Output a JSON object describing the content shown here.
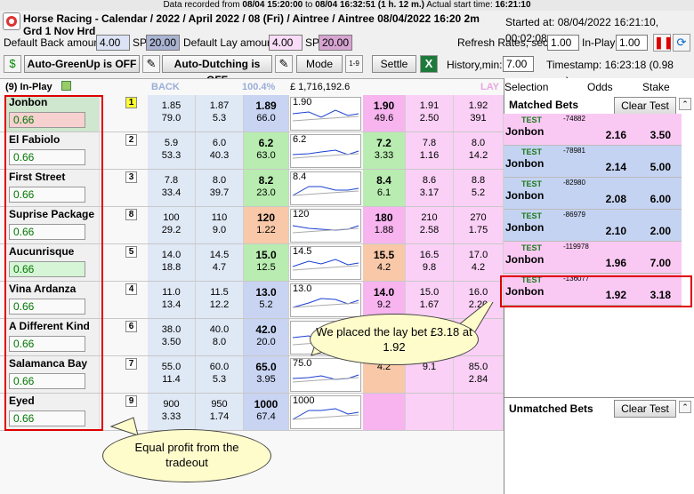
{
  "recorded": {
    "label": "Data recorded from",
    "from": "08/04 15:20:00",
    "to_label": "to",
    "to": "08/04 16:32:51",
    "duration": "(1 h. 12 m.)",
    "start_label": "Actual start time:",
    "start": "16:21:10"
  },
  "header": {
    "title": "Horse Racing - Calendar / 2022 / April 2022 / 08 (Fri) / Aintree / Aintree 08/04/2022 16:20 2m",
    "subtitle": "Grd 1 Nov Hrd",
    "started": "Started at: 08/04/2022 16:21:10, 00:02:08",
    "default_back_label": "Default Back amount:",
    "default_back": "4.00",
    "sp_label": "SP",
    "sp_back": "20.00",
    "default_lay_label": "Default Lay amount:",
    "default_lay": "4.00",
    "sp_lay": "20.00",
    "refresh_label": "Refresh Rates, sec.",
    "refresh": "1.00",
    "inplay_label": "In-Play",
    "inplay": "1.00",
    "autogreen": "Auto-GreenUp is OFF",
    "autodutch": "Auto-Dutching is OFF",
    "mode": "Mode",
    "settle": "Settle",
    "history_label": "History,min:",
    "history": "7.00",
    "timestamp": "Timestamp: 16:23:18 (0.98 sec.)"
  },
  "grid": {
    "inplay": "(9) In-Play",
    "back": "BACK",
    "pct": "100.4%",
    "matched": "£ 1,716,192.6",
    "lay": "LAY",
    "runners": [
      {
        "name": "Jonbon",
        "pl": "0.66",
        "num": "1",
        "b1": [
          "1.85",
          "79.0"
        ],
        "b2": [
          "1.87",
          "5.3"
        ],
        "b3": [
          "1.89",
          "66.0"
        ],
        "spark": "1.90",
        "l1": [
          "1.90",
          "49.6"
        ],
        "l2": [
          "1.91",
          "2.50"
        ],
        "l3": [
          "1.92",
          "391"
        ]
      },
      {
        "name": "El Fabiolo",
        "pl": "0.66",
        "num": "2",
        "b1": [
          "5.9",
          "53.3"
        ],
        "b2": [
          "6.0",
          "40.3"
        ],
        "b3": [
          "6.2",
          "63.0"
        ],
        "spark": "6.2",
        "l1": [
          "7.2",
          "3.33"
        ],
        "l2": [
          "7.8",
          "1.16"
        ],
        "l3": [
          "8.0",
          "14.2"
        ]
      },
      {
        "name": "First Street",
        "pl": "0.66",
        "num": "3",
        "b1": [
          "7.8",
          "33.4"
        ],
        "b2": [
          "8.0",
          "39.7"
        ],
        "b3": [
          "8.2",
          "23.0"
        ],
        "spark": "8.4",
        "l1": [
          "8.4",
          "6.1"
        ],
        "l2": [
          "8.6",
          "3.17"
        ],
        "l3": [
          "8.8",
          "5.2"
        ]
      },
      {
        "name": "Suprise Package",
        "pl": "0.66",
        "num": "8",
        "b1": [
          "100",
          "29.2"
        ],
        "b2": [
          "110",
          "9.0"
        ],
        "b3": [
          "120",
          "1.22"
        ],
        "spark": "120",
        "l1": [
          "180",
          "1.88"
        ],
        "l2": [
          "210",
          "2.58"
        ],
        "l3": [
          "270",
          "1.75"
        ]
      },
      {
        "name": "Aucunrisque",
        "pl": "0.66",
        "num": "5",
        "b1": [
          "14.0",
          "18.8"
        ],
        "b2": [
          "14.5",
          "4.7"
        ],
        "b3": [
          "15.0",
          "12.5"
        ],
        "spark": "14.5",
        "l1": [
          "15.5",
          "4.2"
        ],
        "l2": [
          "16.5",
          "9.8"
        ],
        "l3": [
          "17.0",
          "4.2"
        ]
      },
      {
        "name": "Vina Ardanza",
        "pl": "0.66",
        "num": "4",
        "b1": [
          "11.0",
          "13.4"
        ],
        "b2": [
          "11.5",
          "12.2"
        ],
        "b3": [
          "13.0",
          "5.2"
        ],
        "spark": "13.0",
        "l1": [
          "14.0",
          "9.2"
        ],
        "l2": [
          "15.0",
          "1.67"
        ],
        "l3": [
          "16.0",
          "2.20"
        ]
      },
      {
        "name": "A Different Kind",
        "pl": "0.66",
        "num": "6",
        "b1": [
          "38.0",
          "3.50"
        ],
        "b2": [
          "40.0",
          "8.0"
        ],
        "b3": [
          "42.0",
          "20.0"
        ],
        "spark": "",
        "l1": [
          "",
          ""
        ],
        "l2": [
          "",
          ""
        ],
        "l3": [
          "",
          ""
        ]
      },
      {
        "name": "Salamanca Bay",
        "pl": "0.66",
        "num": "7",
        "b1": [
          "55.0",
          "11.4"
        ],
        "b2": [
          "60.0",
          "5.3"
        ],
        "b3": [
          "65.0",
          "3.95"
        ],
        "spark": "75.0",
        "l1": [
          "",
          "4.2"
        ],
        "l2": [
          "",
          "9.1"
        ],
        "l3": [
          "85.0",
          "2.84"
        ]
      },
      {
        "name": "Eyed",
        "pl": "0.66",
        "num": "9",
        "b1": [
          "900",
          "3.33"
        ],
        "b2": [
          "950",
          "1.74"
        ],
        "b3": [
          "1000",
          "67.4"
        ],
        "spark": "1000",
        "l1": [
          "",
          ""
        ],
        "l2": [
          "",
          ""
        ],
        "l3": [
          "",
          ""
        ]
      }
    ]
  },
  "panel": {
    "selection": "Selection",
    "odds": "Odds",
    "stake": "Stake",
    "matched_title": "Matched Bets",
    "clear": "Clear Test",
    "unmatched_title": "Unmatched Bets",
    "bets": [
      {
        "tag": "TEST",
        "id": "-74882",
        "name": "Jonbon",
        "odds": "2.16",
        "stake": "3.50",
        "side": "lay"
      },
      {
        "tag": "TEST",
        "id": "-78981",
        "name": "Jonbon",
        "odds": "2.14",
        "stake": "5.00",
        "side": "back"
      },
      {
        "tag": "TEST",
        "id": "-82980",
        "name": "Jonbon",
        "odds": "2.08",
        "stake": "6.00",
        "side": "back"
      },
      {
        "tag": "TEST",
        "id": "-86979",
        "name": "Jonbon",
        "odds": "2.10",
        "stake": "2.00",
        "side": "back"
      },
      {
        "tag": "TEST",
        "id": "-119978",
        "name": "Jonbon",
        "odds": "1.96",
        "stake": "7.00",
        "side": "lay"
      },
      {
        "tag": "TEST",
        "id": "-136077",
        "name": "Jonbon",
        "odds": "1.92",
        "stake": "3.18",
        "side": "lay"
      }
    ]
  },
  "callouts": {
    "lay": "We placed the lay bet £3.18 at 1.92",
    "equal": "Equal profit from the tradeout"
  },
  "colors": {
    "back": "#c8d4f2",
    "lay": "#f7b4ef",
    "highlight": "#e00000",
    "callout": "#fffccc"
  }
}
